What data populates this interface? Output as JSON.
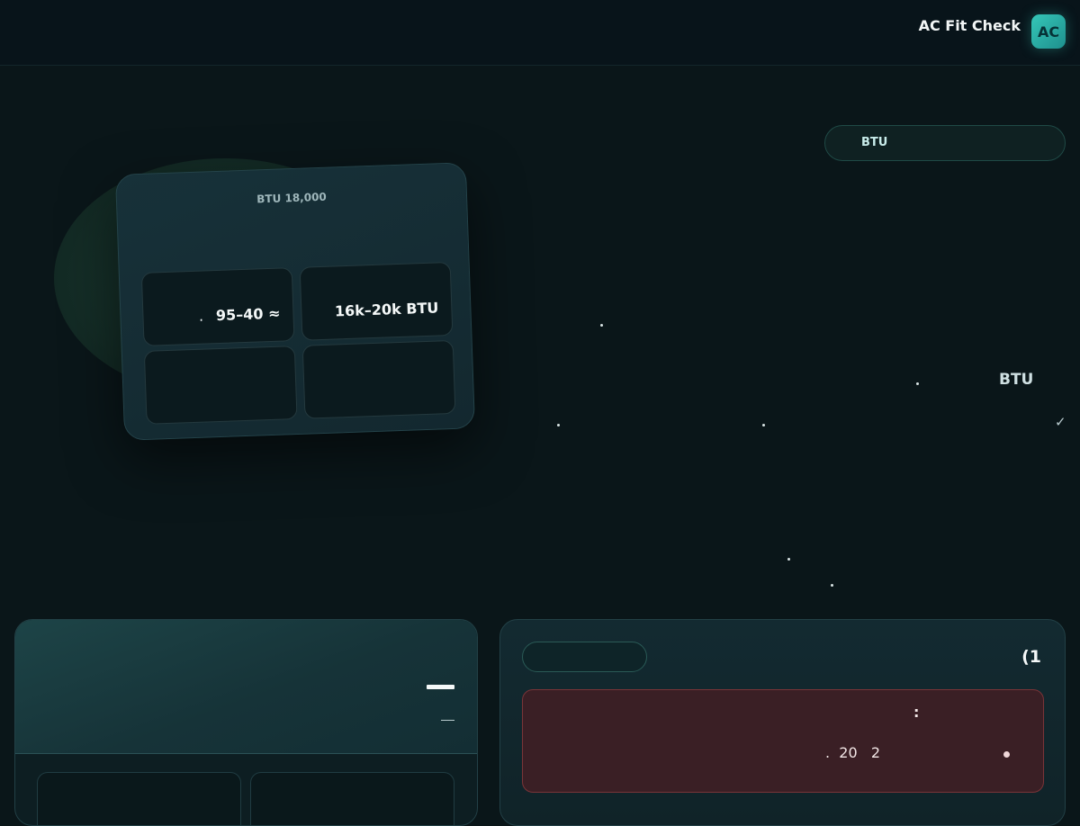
{
  "header": {
    "brand": "AC Fit Check",
    "avatar_initials": "AC"
  },
  "filter_pill": {
    "label": "BTU"
  },
  "hero_card": {
    "title": "BTU 18,000",
    "tiles": [
      {
        "lead": ".",
        "value": "95–40 ≈"
      },
      {
        "lead": "",
        "value": "16k–20k BTU"
      },
      {
        "lead": "",
        "value": ""
      },
      {
        "lead": "",
        "value": ""
      }
    ]
  },
  "content": {
    "btu_label": "BTU",
    "check_mark": "✓"
  },
  "right_panel": {
    "paren_text": "(1",
    "alert": {
      "colon": ":",
      "line": ".  20   2"
    }
  },
  "colors": {
    "background": "#0a1619",
    "accent": "#35c7b8",
    "alert_bg": "#3a1f25",
    "alert_border": "#7a3438"
  }
}
